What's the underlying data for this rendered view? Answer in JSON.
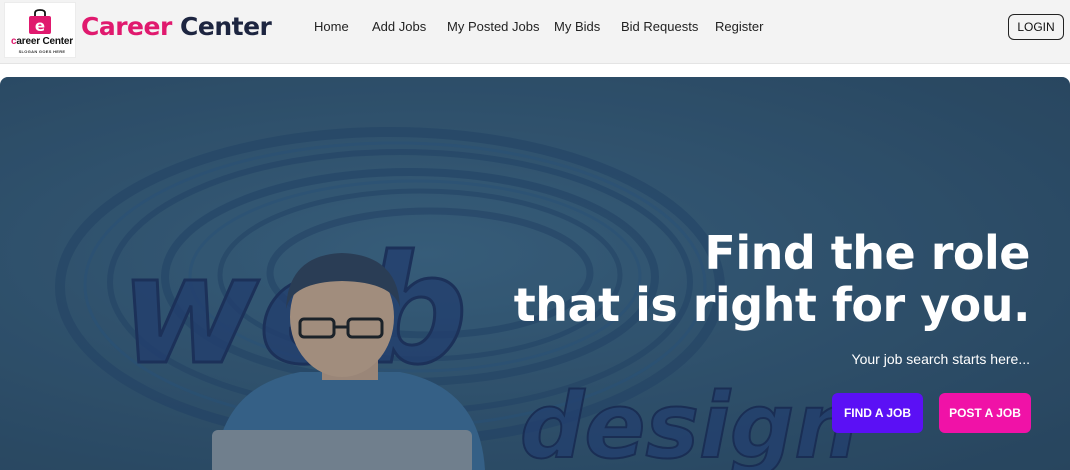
{
  "logo": {
    "title_first": "c",
    "title_rest": "areer Center",
    "slogan": "SLOGAN GOES HERE",
    "bag_letter": "e"
  },
  "brand": {
    "part1": "Career",
    "part2": "Center"
  },
  "nav": {
    "items": [
      {
        "label": "Home"
      },
      {
        "label": "Add Jobs"
      },
      {
        "label": "My Posted Jobs"
      },
      {
        "label": "My Bids"
      },
      {
        "label": "Bid Requests"
      },
      {
        "label": "Register"
      }
    ],
    "login_label": "LOGIN"
  },
  "hero": {
    "title_line1": "Find the role",
    "title_line2": "that is right for you.",
    "subtitle": "Your job search starts here...",
    "find_label": "FIND A JOB",
    "post_label": "POST A JOB",
    "background_word": "web design"
  },
  "colors": {
    "brand_pink": "#e0196e",
    "brand_navy": "#1d2540",
    "find_button": "#5b10f5",
    "post_button": "#f012a7",
    "hero_bg": "#355a76"
  }
}
